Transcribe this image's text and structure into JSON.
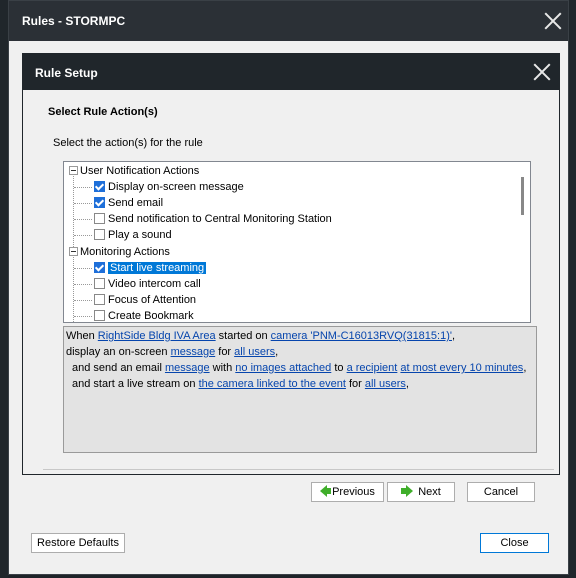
{
  "window": {
    "title": "Rules - STORMPC"
  },
  "dialog": {
    "title": "Rule Setup",
    "section_title": "Select Rule Action(s)",
    "instruction": "Select the action(s) for the rule"
  },
  "tree": {
    "groups": [
      {
        "label": "User Notification Actions"
      },
      {
        "label": "Monitoring Actions"
      }
    ],
    "items": [
      {
        "label": "Display on-screen message",
        "checked": true
      },
      {
        "label": "Send email",
        "checked": true
      },
      {
        "label": "Send notification to Central Monitoring Station",
        "checked": false
      },
      {
        "label": "Play a sound",
        "checked": false
      },
      {
        "label": "Start live streaming",
        "checked": true,
        "selected": true
      },
      {
        "label": "Video intercom call",
        "checked": false
      },
      {
        "label": "Focus of Attention",
        "checked": false
      },
      {
        "label": "Create Bookmark",
        "checked": false
      }
    ]
  },
  "summary": {
    "l1_a": "When ",
    "l1_link1": "RightSide Bldg IVA Area",
    "l1_b": " started on ",
    "l1_link2": "camera 'PNM-C16013RVQ(31815:1)'",
    "l1_c": ",",
    "l2_a": "display an on-screen ",
    "l2_link1": "message",
    "l2_b": " for ",
    "l2_link2": "all users",
    "l2_c": ",",
    "l3_a": "and send an email ",
    "l3_link1": "message",
    "l3_b": " with ",
    "l3_link2": "no images attached",
    "l3_c": " to ",
    "l3_link3": "a recipient",
    "l3_d": " ",
    "l3_link4": "at most every 10 minutes",
    "l3_e": ",",
    "l4_a": "and start a live stream on ",
    "l4_link1": "the camera linked to the event",
    "l4_b": " for ",
    "l4_link2": "all users",
    "l4_c": ","
  },
  "buttons": {
    "previous": "Previous",
    "next": "Next",
    "cancel": "Cancel",
    "restore": "Restore Defaults",
    "close": "Close"
  },
  "colors": {
    "title_bar": "#20262b",
    "link": "#0645ad",
    "selection": "#0078d7",
    "check": "#1e6fd9",
    "arrow": "#3fae2a"
  }
}
